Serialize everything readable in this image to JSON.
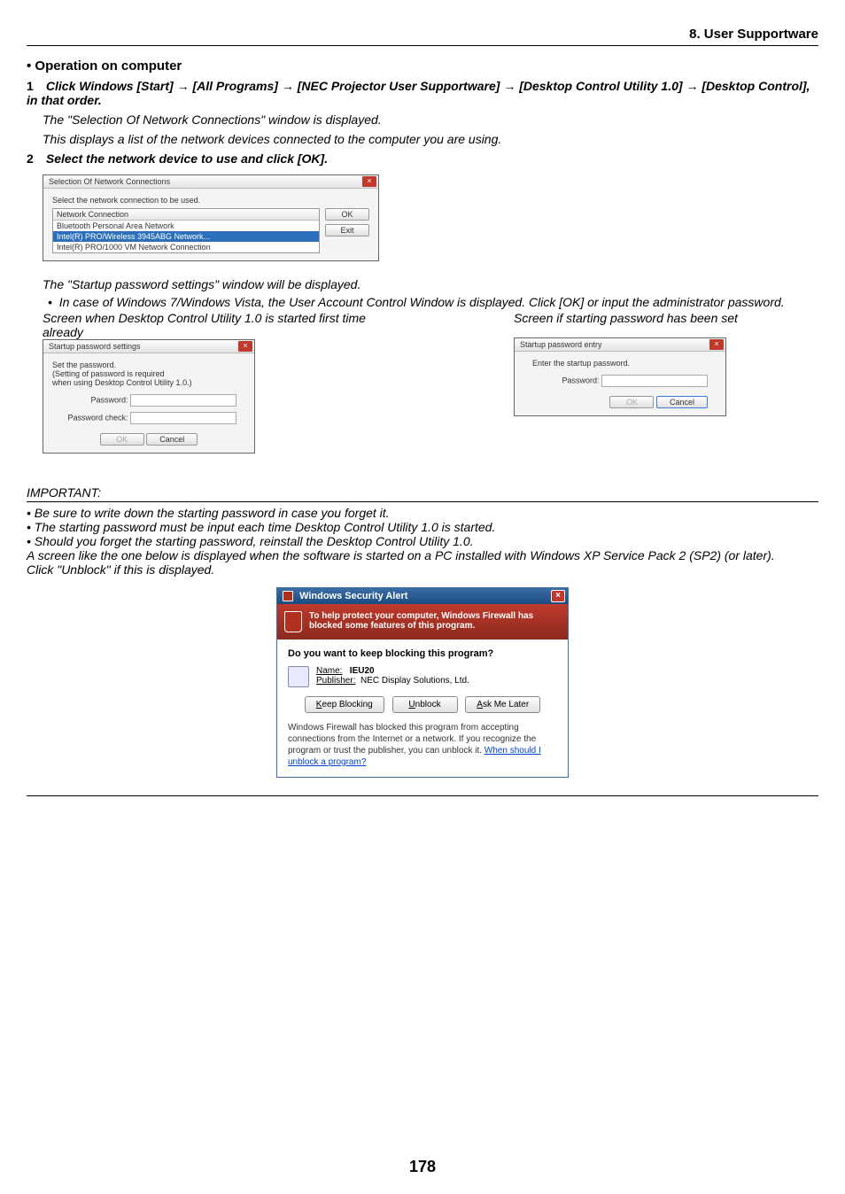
{
  "header": {
    "chapter": "8. User Supportware"
  },
  "section_title": "• Operation on computer",
  "step1": {
    "prefix": "1",
    "text_parts": [
      "Click Windows [Start] ",
      " [All Programs] ",
      " [NEC Projector User Supportware] ",
      " [Desktop Control Utility 1.0] ",
      " [Desktop Control], in that order."
    ],
    "arrow": "→",
    "line1": "The \"Selection Of Network Connections\" window is displayed.",
    "line2": "This displays a list of the network devices connected to the computer you are using."
  },
  "step2": {
    "prefix": "2",
    "text": "Select the network device to use and click [OK].",
    "dlg": {
      "title": "Selection Of Network Connections",
      "instruction": "Select the network connection to be used.",
      "col_header": "Network Connection",
      "rows": [
        "Bluetooth Personal Area Network",
        "Intel(R) PRO/Wireless 3945ABG Network...",
        "Intel(R) PRO/1000 VM Network Connection"
      ],
      "ok": "OK",
      "exit": "Exit"
    },
    "after1": "The \"Startup password settings\" window will be displayed.",
    "bullet1": "In case of Windows 7/Windows Vista, the User Account Control Window is displayed. Click [OK] or input the administrator password.",
    "col1_label": "Screen when Desktop Control Utility 1.0 is started first time already",
    "col2_label": "Screen if starting password has been set",
    "dlg1": {
      "title": "Startup password settings",
      "line1": "Set the password.",
      "line2": "(Setting of password is required",
      "line3": "when using Desktop Control Utility 1.0.)",
      "pw_label": "Password:",
      "pwc_label": "Password check:",
      "ok": "OK",
      "cancel": "Cancel"
    },
    "dlg2": {
      "title": "Startup password entry",
      "line1": "Enter the startup password.",
      "pw_label": "Password:",
      "ok": "OK",
      "cancel": "Cancel"
    }
  },
  "important": {
    "label": "IMPORTANT:",
    "b1": "Be sure to write down the starting password in case you forget it.",
    "b2": "The starting password must be input each time Desktop Control Utility 1.0 is started.",
    "b3": "Should you forget the starting password, reinstall the Desktop Control Utility 1.0.",
    "para": "A screen like the one below is displayed when the software is started on a PC installed with Windows XP Service Pack 2 (SP2) (or later).",
    "click": "Click \"Unblock\" if this is displayed."
  },
  "alert": {
    "title": "Windows Security Alert",
    "banner": "To help protect your computer, Windows Firewall has blocked some features of this program.",
    "question": "Do you want to keep blocking this program?",
    "name_label": "Name:",
    "name_value": "IEU20",
    "pub_label": "Publisher:",
    "pub_value": "NEC Display Solutions, Ltd.",
    "btn_keep": "Keep Blocking",
    "btn_unblock": "Unblock",
    "btn_ask": "Ask Me Later",
    "footer": "Windows Firewall has blocked this program from accepting connections from the Internet or a network. If you recognize the program or trust the publisher, you can unblock it. ",
    "footer_link": "When should I unblock a program?"
  },
  "page_number": "178"
}
